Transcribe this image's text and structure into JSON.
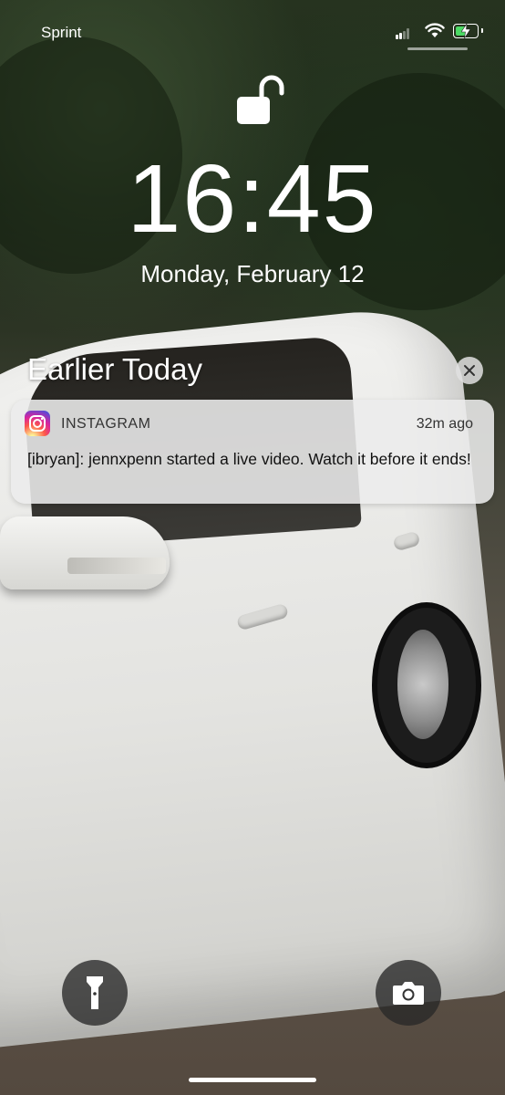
{
  "status_bar": {
    "carrier": "Sprint",
    "battery_color": "#4cd964",
    "battery_level": 0.55
  },
  "lock_screen": {
    "time": "16:45",
    "date": "Monday, February 12",
    "lock_state": "unlocked"
  },
  "notifications": {
    "section_title": "Earlier Today",
    "items": [
      {
        "app_icon": "instagram-icon",
        "app_name": "INSTAGRAM",
        "time": "32m ago",
        "body": "[ibryan]: jennxpenn started a live video. Watch it before it ends!"
      }
    ]
  },
  "controls": {
    "left_icon": "flashlight-icon",
    "right_icon": "camera-icon"
  }
}
